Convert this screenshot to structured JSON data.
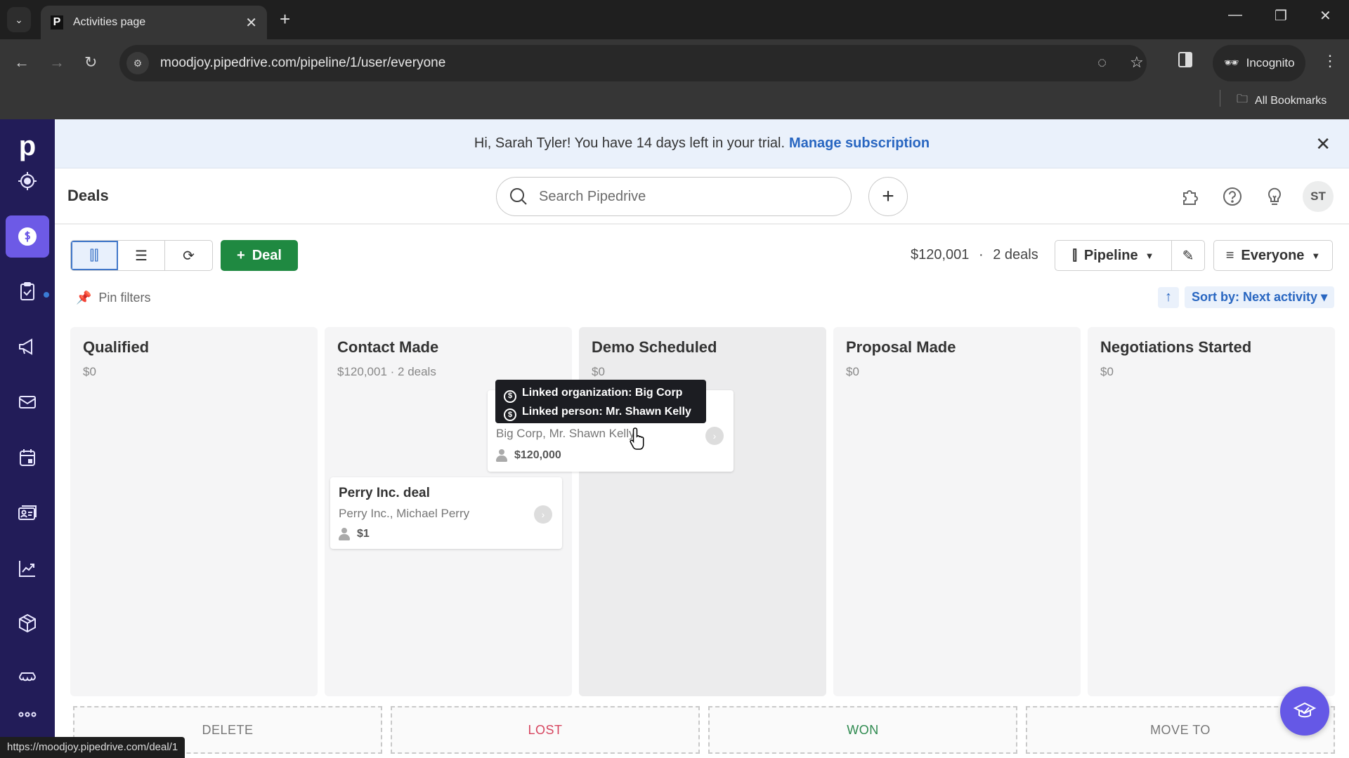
{
  "browser": {
    "tab_title": "Activities page",
    "tab_favicon": "P",
    "url": "moodjoy.pipedrive.com/pipeline/1/user/everyone",
    "incognito_label": "Incognito",
    "bookmarks_label": "All Bookmarks",
    "status_url": "https://moodjoy.pipedrive.com/deal/1"
  },
  "sidebar": {
    "logo": "p",
    "items": [
      {
        "name": "leads",
        "icon": "target-icon"
      },
      {
        "name": "deals",
        "icon": "dollar-icon",
        "active": true
      },
      {
        "name": "activities",
        "icon": "clipboard-check-icon"
      },
      {
        "name": "campaigns",
        "icon": "megaphone-icon"
      },
      {
        "name": "mail",
        "icon": "mail-icon"
      },
      {
        "name": "calendar",
        "icon": "calendar-icon"
      },
      {
        "name": "contacts",
        "icon": "contact-card-icon"
      },
      {
        "name": "insights",
        "icon": "chart-icon"
      },
      {
        "name": "products",
        "icon": "box-icon"
      },
      {
        "name": "marketplace",
        "icon": "storefront-icon"
      },
      {
        "name": "more",
        "icon": "more-icon"
      }
    ]
  },
  "banner": {
    "text": "Hi, Sarah Tyler! You have 14 days left in your trial.",
    "link": "Manage subscription"
  },
  "header": {
    "title": "Deals",
    "search_placeholder": "Search Pipedrive",
    "avatar_initials": "ST"
  },
  "toolbar": {
    "add_deal_label": "Deal",
    "summary_value": "$120,001",
    "summary_sep": "·",
    "summary_count": "2 deals",
    "pipeline_label": "Pipeline",
    "owner_filter_label": "Everyone",
    "pin_filters_label": "Pin filters",
    "sort_label": "Sort by: Next activity"
  },
  "stages": [
    {
      "name": "Qualified",
      "meta": "$0"
    },
    {
      "name": "Contact Made",
      "meta": "$120,001 · 2 deals"
    },
    {
      "name": "Demo Scheduled",
      "meta": "$0"
    },
    {
      "name": "Proposal Made",
      "meta": "$0"
    },
    {
      "name": "Negotiations Started",
      "meta": "$0"
    }
  ],
  "deals": [
    {
      "subtitle": "Big Corp, Mr. Shawn Kelly",
      "value": "$120,000"
    },
    {
      "title": "Perry Inc. deal",
      "subtitle": "Perry Inc., Michael Perry",
      "value": "$1"
    }
  ],
  "tooltip": {
    "line1": "Linked organization: Big Corp",
    "line2": "Linked person: Mr. Shawn Kelly"
  },
  "drop_zones": [
    {
      "label": "DELETE",
      "color": "#777777"
    },
    {
      "label": "LOST",
      "color": "#d6455f"
    },
    {
      "label": "WON",
      "color": "#2e8a4f"
    },
    {
      "label": "MOVE TO",
      "color": "#777777"
    }
  ]
}
